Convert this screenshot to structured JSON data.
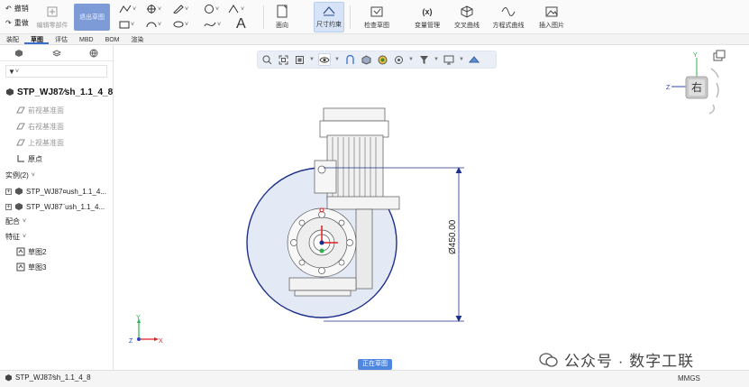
{
  "ribbon": {
    "undo_label": "撤销",
    "redo_label": "重做",
    "edit_part_label": "编辑零部件",
    "exit_sketch_label": "退出草图",
    "sketch_text_glyph": "A",
    "face_label": "面向",
    "dimension_constraint_label": "尺寸约束",
    "check_sketch_label": "检查草图",
    "variable_manager_label": "变量管理",
    "intersection_curve_label": "交叉曲线",
    "equation_curve_label": "方程式曲线",
    "insert_image_label": "插入图片"
  },
  "tabs": [
    {
      "label": "装配",
      "active": false
    },
    {
      "label": "草图",
      "active": true
    },
    {
      "label": "评估",
      "active": false
    },
    {
      "label": "MBD",
      "active": false
    },
    {
      "label": "BOM",
      "active": false
    },
    {
      "label": "渲染",
      "active": false
    }
  ],
  "tree": {
    "root": "STP_WJ87⁄sh_1.1_4_8",
    "planes": [
      "前视基准面",
      "右视基准面",
      "上视基准面"
    ],
    "origin": "原点",
    "instances_header": "实例(2)",
    "instances": [
      "STP_WJ87¤ush_1.1_4...",
      "STP_WJ87¨ush_1.1_4..."
    ],
    "mates_header": "配合",
    "features_header": "特征",
    "features": [
      "草图2",
      "草图3"
    ]
  },
  "viewport": {
    "dimension_label": "Ø450.00",
    "sketch_mode_badge": "正在草图",
    "viewcube_face": "右",
    "triad_x": "X",
    "triad_y": "Y",
    "triad_z": "Z"
  },
  "statusbar": {
    "document": "STP_WJ87⁄sh_1.1_4_8",
    "units": "MMGS"
  },
  "watermark": "公众号 · 数字工联",
  "colors": {
    "accent": "#3a6fd1",
    "exit_sketch_bg": "#7d9bd6",
    "sketch_circle_fill": "#e3eaf6",
    "sketch_blue": "#1c2f8a"
  }
}
